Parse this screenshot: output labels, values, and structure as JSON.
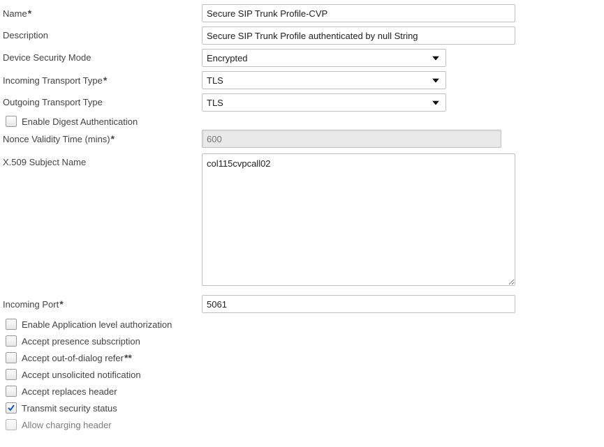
{
  "fields": {
    "name": {
      "label": "Name",
      "value": "Secure SIP Trunk Profile-CVP"
    },
    "description": {
      "label": "Description",
      "value": "Secure SIP Trunk Profile authenticated by null String"
    },
    "deviceSecurityMode": {
      "label": "Device Security Mode",
      "selected": "Encrypted"
    },
    "incomingTransportType": {
      "label": "Incoming Transport Type",
      "selected": "TLS"
    },
    "outgoingTransportType": {
      "label": "Outgoing Transport Type",
      "selected": "TLS"
    },
    "enableDigestAuth": {
      "label": "Enable Digest Authentication",
      "checked": false
    },
    "nonceValidity": {
      "label": "Nonce Validity Time (mins)",
      "value": "600"
    },
    "x509SubjectName": {
      "label": "X.509 Subject Name",
      "value": "col115cvpcall02"
    },
    "incomingPort": {
      "label": "Incoming Port",
      "value": "5061"
    },
    "enableAppLevelAuth": {
      "label": "Enable Application level authorization",
      "checked": false
    },
    "acceptPresenceSub": {
      "label": "Accept presence subscription",
      "checked": false
    },
    "acceptOodRefer": {
      "label": "Accept out-of-dialog refer",
      "checked": false
    },
    "acceptUnsolicitedNotif": {
      "label": "Accept unsolicited notification",
      "checked": false
    },
    "acceptReplacesHeader": {
      "label": "Accept replaces header",
      "checked": false
    },
    "transmitSecurityStatus": {
      "label": "Transmit security status",
      "checked": true
    },
    "allowChargingHeader": {
      "label": "Allow charging header",
      "checked": false
    }
  },
  "markers": {
    "required": "*",
    "doubleStar": "**"
  }
}
